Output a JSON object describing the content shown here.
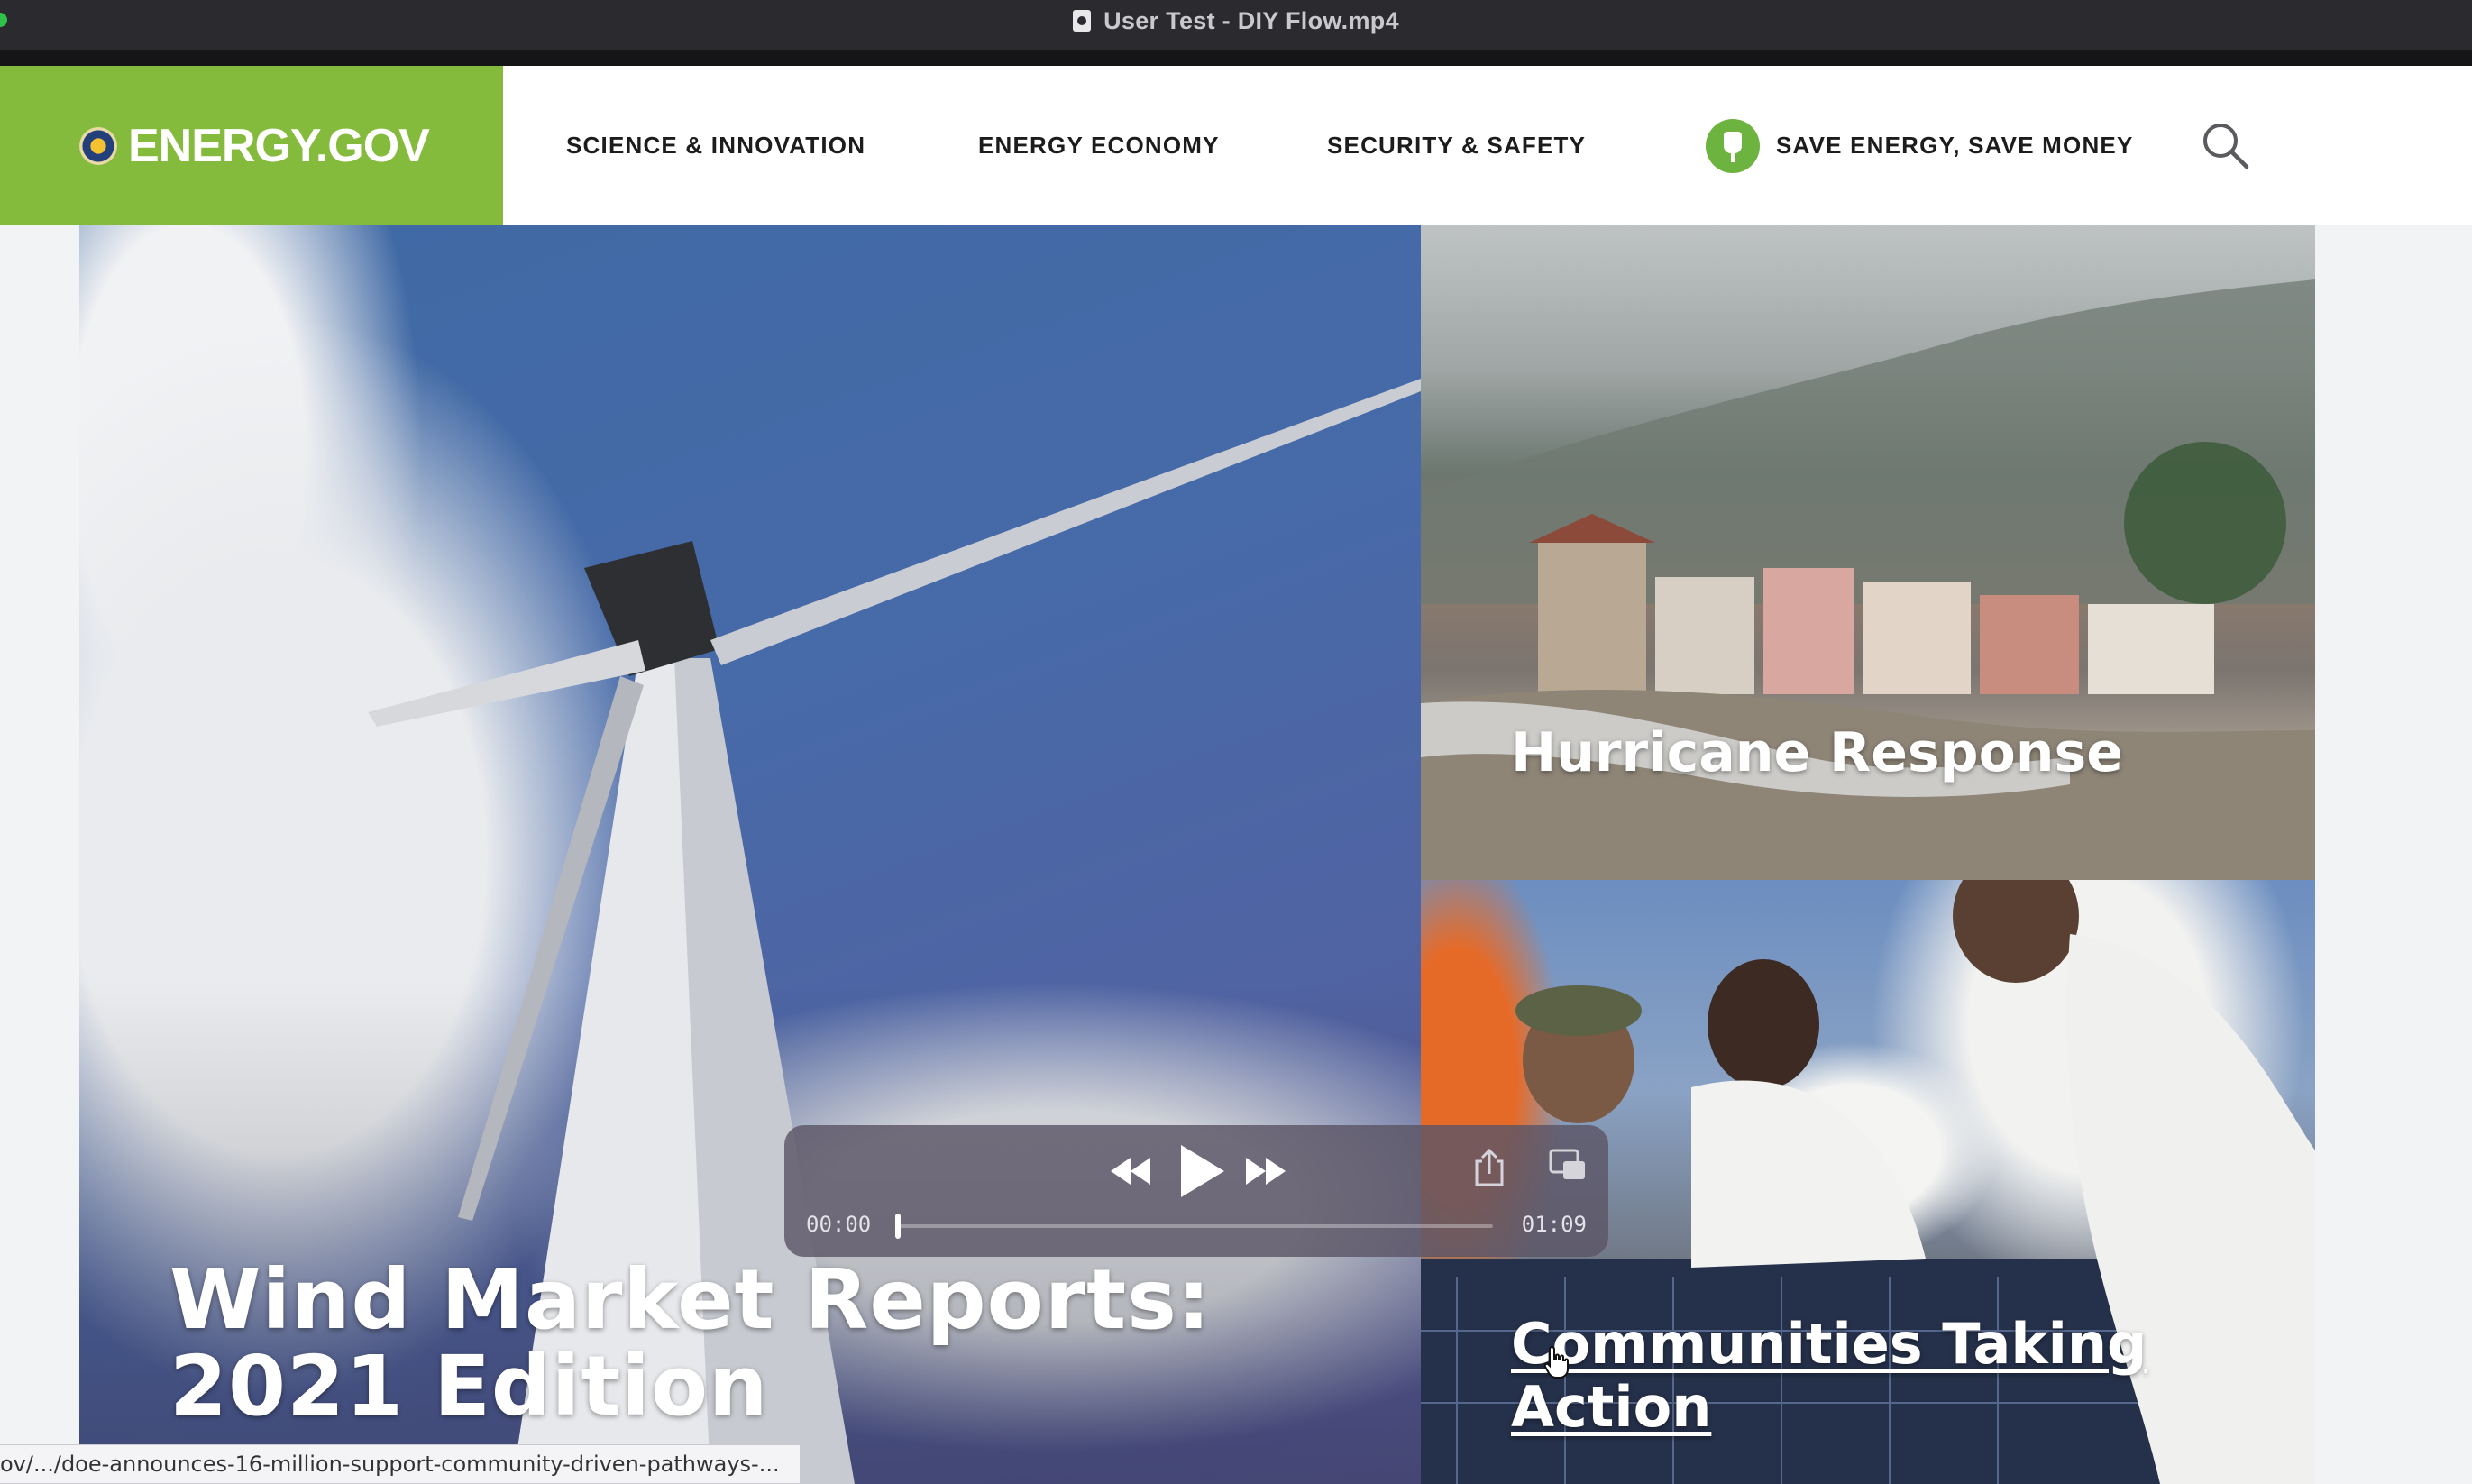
{
  "window": {
    "title": "User Test - DIY Flow.mp4"
  },
  "header": {
    "logo_text": "ENERGY.GOV",
    "nav": {
      "science": "SCIENCE & INNOVATION",
      "economy": "ENERGY ECONOMY",
      "security": "SECURITY & SAFETY",
      "save": "SAVE ENERGY, SAVE MONEY"
    }
  },
  "hero": {
    "main_title": "Wind Market Reports: 2021 Edition",
    "hurricane_title": "Hurricane Response",
    "communities_title": "Communities Taking Action"
  },
  "player": {
    "current_time": "00:00",
    "duration": "01:09",
    "progress": 0.0
  },
  "statusbar": {
    "url": "ov/.../doe-announces-16-million-support-community-driven-pathways-..."
  },
  "colors": {
    "brand_green": "#84bb3c",
    "plug_green": "#6cb33f",
    "titlebar": "#2b2a2f"
  },
  "icons": [
    "seal-icon",
    "plug-icon",
    "search-icon",
    "rewind-icon",
    "play-icon",
    "forward-icon",
    "share-icon",
    "picture-in-picture-icon",
    "hand-cursor-icon",
    "file-icon"
  ]
}
